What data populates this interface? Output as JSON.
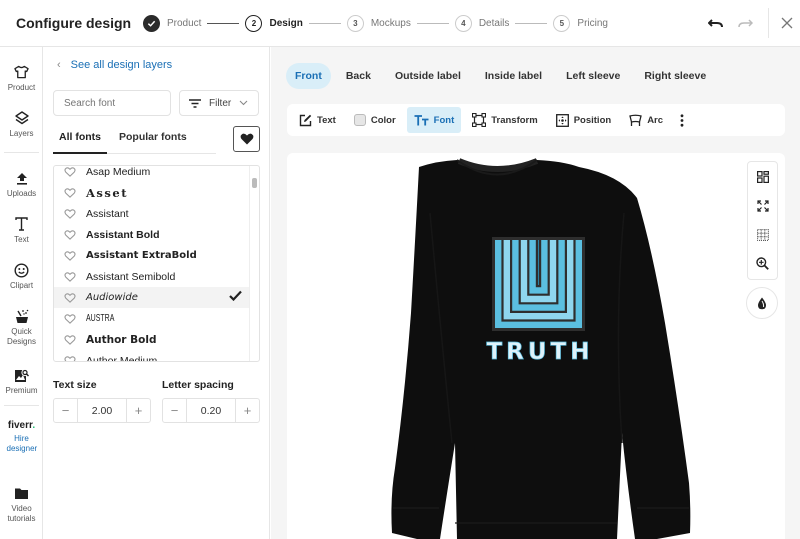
{
  "header": {
    "title": "Configure design",
    "steps": [
      {
        "number": "1",
        "label": "Product",
        "state": "done"
      },
      {
        "number": "2",
        "label": "Design",
        "state": "active"
      },
      {
        "number": "3",
        "label": "Mockups",
        "state": "pending"
      },
      {
        "number": "4",
        "label": "Details",
        "state": "pending"
      },
      {
        "number": "5",
        "label": "Pricing",
        "state": "pending"
      }
    ],
    "icons": {
      "undo": "undo-icon",
      "redo": "redo-icon",
      "close": "close-icon"
    }
  },
  "rail": {
    "items": [
      {
        "label": "Product",
        "icon": "tshirt-icon"
      },
      {
        "label": "Layers",
        "icon": "layers-icon"
      },
      {
        "label": "Uploads",
        "icon": "upload-icon"
      },
      {
        "label": "Text",
        "icon": "text-icon"
      },
      {
        "label": "Clipart",
        "icon": "smiley-icon"
      },
      {
        "label": "Quick Designs",
        "icon": "magic-wand-icon"
      },
      {
        "label": "Premium",
        "icon": "premium-image-icon"
      },
      {
        "label": "Video tutorials",
        "icon": "folder-icon"
      }
    ],
    "fiverr": {
      "logo": "fiverr",
      "logo_dot": ".",
      "label": "Hire designer"
    }
  },
  "panel": {
    "back_link": "See all design layers",
    "search_placeholder": "Search font",
    "filter_label": "Filter",
    "tabs": [
      {
        "label": "All fonts",
        "active": true
      },
      {
        "label": "Popular fonts",
        "active": false
      }
    ],
    "fonts": [
      {
        "name": "Asap Medium",
        "selected": false
      },
      {
        "name": "Asset",
        "selected": false
      },
      {
        "name": "Assistant",
        "selected": false
      },
      {
        "name": "Assistant Bold",
        "selected": false
      },
      {
        "name": "Assistant ExtraBold",
        "selected": false
      },
      {
        "name": "Assistant Semibold",
        "selected": false
      },
      {
        "name": "Audiowide",
        "selected": true
      },
      {
        "name": "AUSTRA",
        "selected": false
      },
      {
        "name": "Author Bold",
        "selected": false
      },
      {
        "name": "Author Medium",
        "selected": false
      }
    ],
    "text_size": {
      "label": "Text size",
      "value": "2.00"
    },
    "letter_spacing": {
      "label": "Letter spacing",
      "value": "0.20"
    },
    "minus": "−",
    "plus": "+"
  },
  "main": {
    "views": [
      {
        "label": "Front",
        "active": true
      },
      {
        "label": "Back",
        "active": false
      },
      {
        "label": "Outside label",
        "active": false
      },
      {
        "label": "Inside label",
        "active": false
      },
      {
        "label": "Left sleeve",
        "active": false
      },
      {
        "label": "Right sleeve",
        "active": false
      }
    ],
    "tools": [
      {
        "label": "Text",
        "icon": "edit-text-icon",
        "active": false
      },
      {
        "label": "Color",
        "icon": "color-swatch-icon",
        "active": false
      },
      {
        "label": "Font",
        "icon": "font-icon",
        "active": true
      },
      {
        "label": "Transform",
        "icon": "transform-icon",
        "active": false
      },
      {
        "label": "Position",
        "icon": "position-icon",
        "active": false
      },
      {
        "label": "Arc",
        "icon": "arc-icon",
        "active": false
      }
    ],
    "design_text": "TRUTH",
    "colors": {
      "accent": "#1a6fb5",
      "active_bg": "#d9eef8",
      "garment": "#0e0e0e",
      "logo_light": "#5bbfe0",
      "logo_dark": "#2a7fa0",
      "text_fill": "#dff3fb"
    }
  }
}
